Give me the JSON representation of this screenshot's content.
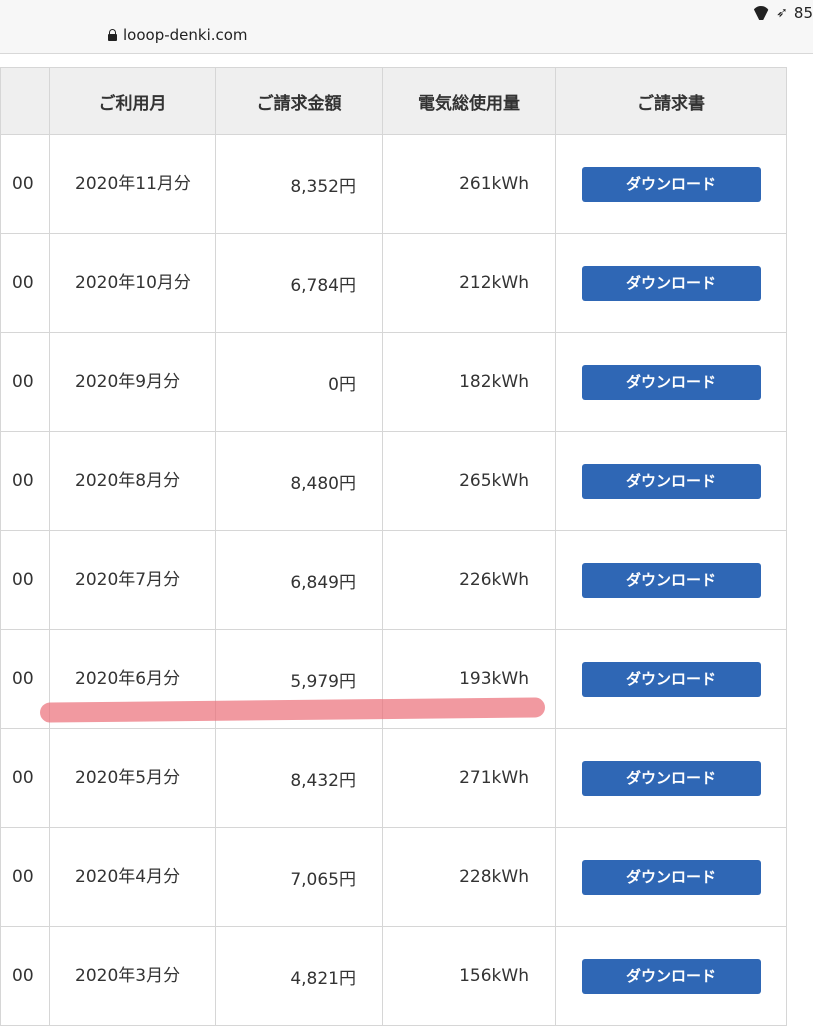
{
  "browser": {
    "url": "looop-denki.com",
    "battery": "85"
  },
  "table": {
    "headers": [
      "",
      "ご利用月",
      "ご請求金額",
      "電気総使用量",
      "ご請求書"
    ],
    "rows": [
      {
        "left": "00",
        "month": "2020年11月分",
        "amount": "8,352円",
        "usage": "261kWh",
        "button": "ダウンロード"
      },
      {
        "left": "00",
        "month": "2020年10月分",
        "amount": "6,784円",
        "usage": "212kWh",
        "button": "ダウンロード"
      },
      {
        "left": "00",
        "month": "2020年9月分",
        "amount": "0円",
        "usage": "182kWh",
        "button": "ダウンロード"
      },
      {
        "left": "00",
        "month": "2020年8月分",
        "amount": "8,480円",
        "usage": "265kWh",
        "button": "ダウンロード"
      },
      {
        "left": "00",
        "month": "2020年7月分",
        "amount": "6,849円",
        "usage": "226kWh",
        "button": "ダウンロード"
      },
      {
        "left": "00",
        "month": "2020年6月分",
        "amount": "5,979円",
        "usage": "193kWh",
        "button": "ダウンロード"
      },
      {
        "left": "00",
        "month": "2020年5月分",
        "amount": "8,432円",
        "usage": "271kWh",
        "button": "ダウンロード"
      },
      {
        "left": "00",
        "month": "2020年4月分",
        "amount": "7,065円",
        "usage": "228kWh",
        "button": "ダウンロード"
      },
      {
        "left": "00",
        "month": "2020年3月分",
        "amount": "4,821円",
        "usage": "156kWh",
        "button": "ダウンロード"
      }
    ]
  },
  "colors": {
    "button": "#2f67b5",
    "header_bg": "#efefef",
    "highlight": "#eb6e78"
  }
}
